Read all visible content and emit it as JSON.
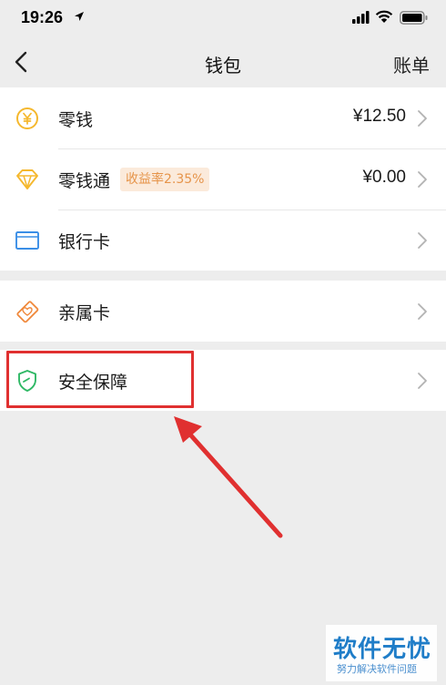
{
  "status_bar": {
    "time": "19:26"
  },
  "nav": {
    "title": "钱包",
    "right_label": "账单"
  },
  "wallet_group": [
    {
      "label": "零钱",
      "value": "¥12.50",
      "icon": "yuan-coin-icon"
    },
    {
      "label": "零钱通",
      "badge": "收益率2.35%",
      "value": "¥0.00",
      "icon": "diamond-icon"
    },
    {
      "label": "银行卡",
      "icon": "bank-card-icon"
    }
  ],
  "family_group": [
    {
      "label": "亲属卡",
      "icon": "family-card-icon"
    }
  ],
  "security_group": [
    {
      "label": "安全保障",
      "icon": "shield-icon"
    }
  ],
  "colors": {
    "page_bg": "#ededed",
    "yuan_icon": "#f5b82e",
    "badge_bg": "#fbeadb",
    "badge_text": "#e6944a",
    "bank_icon": "#3a8ee6",
    "family_icon": "#f0893c",
    "shield_icon": "#2fb865",
    "annotation_red": "#e03030"
  },
  "watermark": {
    "main": "软件无忧",
    "sub": "努力解决软件问题"
  }
}
